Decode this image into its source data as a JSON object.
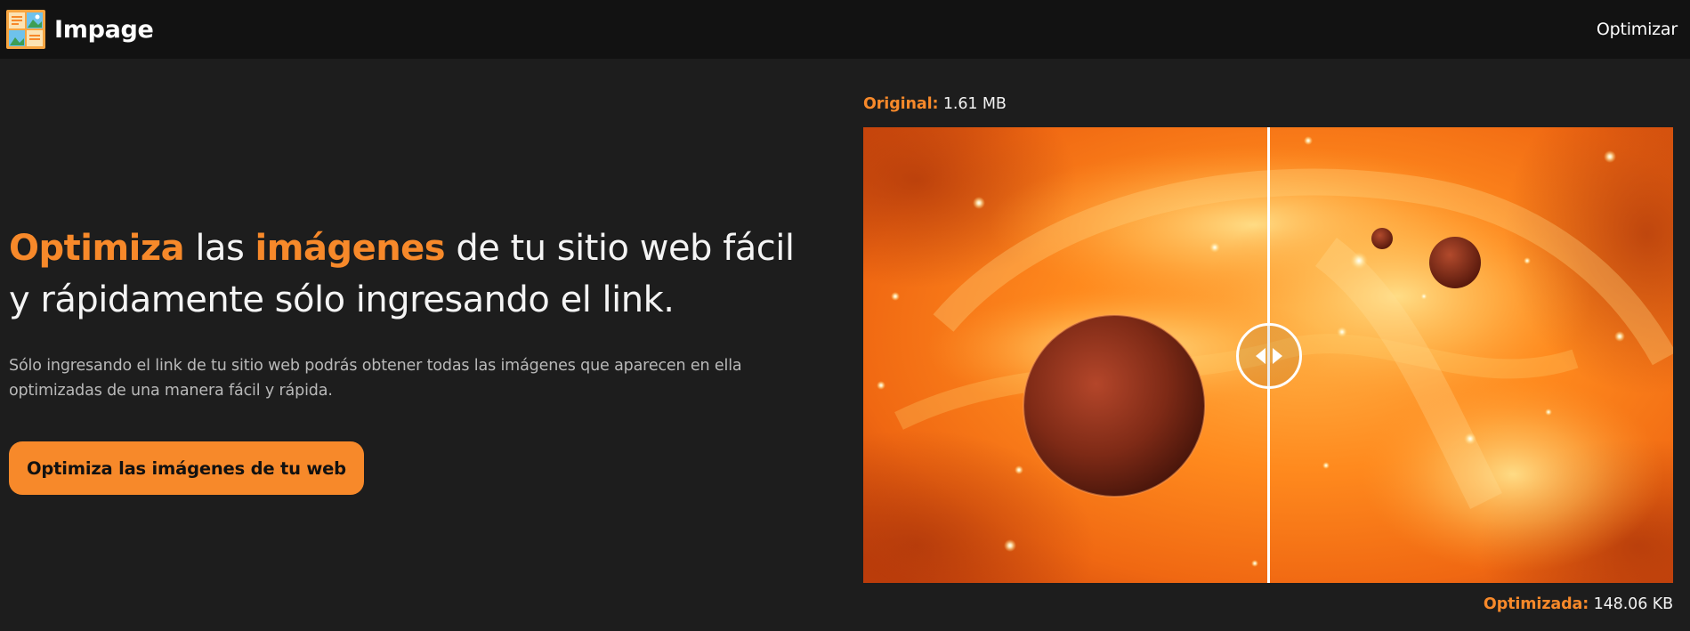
{
  "navbar": {
    "brand": "Impage",
    "link": "Optimizar"
  },
  "hero": {
    "headline": {
      "accent1": "Optimiza",
      "text1": " las ",
      "accent2": "imágenes",
      "text2": " de tu sitio web fácil y rápidamente sólo ingresando el link."
    },
    "lead": "Sólo ingresando el link de tu sitio web podrás obtener todas las imágenes que aparecen en ella optimizadas de una manera fácil y rápida.",
    "cta_label": "Optimiza las imágenes de tu web"
  },
  "comparison": {
    "original_key": "Original:",
    "original_value": " 1.61 MB",
    "optimized_key": "Optimizada:",
    "optimized_value": " 148.06 KB",
    "slider_position": 0.5
  },
  "colors": {
    "accent": "#f7892a",
    "background": "#1d1d1d",
    "navbar": "#121212"
  },
  "icons": {
    "logo": "image-gallery-icon",
    "handle": "left-right-arrows-icon"
  }
}
